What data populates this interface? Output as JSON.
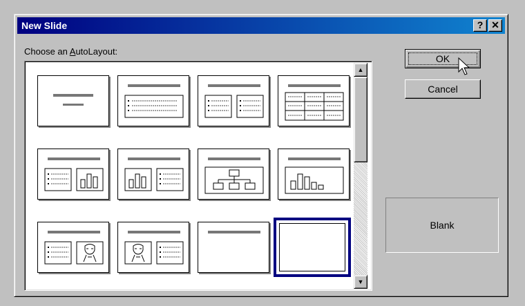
{
  "dialog": {
    "title": "New Slide",
    "help_button": "?",
    "close_button": "✕",
    "choose_label_prefix": "Choose an ",
    "choose_label_accel": "A",
    "choose_label_suffix": "utoLayout:",
    "ok_label": "OK",
    "cancel_label": "Cancel",
    "preview_label": "Blank"
  },
  "layouts": [
    {
      "name": "title-slide",
      "selected": false
    },
    {
      "name": "bulleted-list",
      "selected": false
    },
    {
      "name": "two-column-text",
      "selected": false
    },
    {
      "name": "table",
      "selected": false
    },
    {
      "name": "text-and-chart",
      "selected": false
    },
    {
      "name": "chart-and-text",
      "selected": false
    },
    {
      "name": "organization-chart",
      "selected": false
    },
    {
      "name": "chart",
      "selected": false
    },
    {
      "name": "text-and-clip-art",
      "selected": false
    },
    {
      "name": "clip-art-and-text",
      "selected": false
    },
    {
      "name": "title-only",
      "selected": false
    },
    {
      "name": "blank",
      "selected": true
    }
  ],
  "colors": {
    "titlebar_start": "#000080",
    "titlebar_end": "#1084d0",
    "selection": "#000080",
    "face": "#c0c0c0"
  },
  "icons": [
    "help-icon",
    "close-icon",
    "scroll-up-icon",
    "scroll-down-icon",
    "mouse-pointer-icon"
  ]
}
